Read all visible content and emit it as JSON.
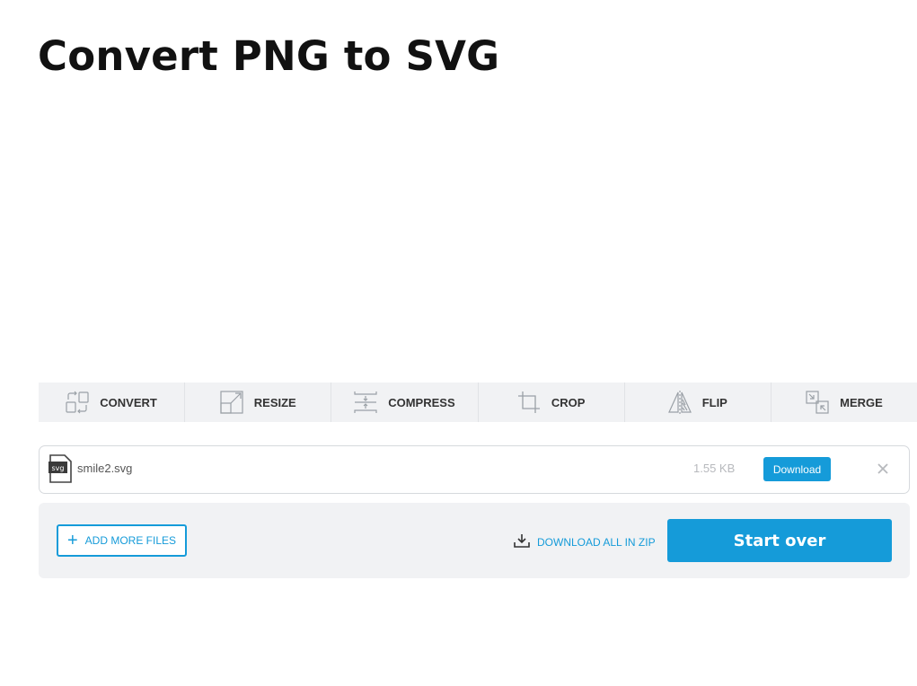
{
  "page": {
    "title": "Convert PNG to SVG"
  },
  "tools": [
    {
      "label": "CONVERT",
      "icon": "convert-icon"
    },
    {
      "label": "RESIZE",
      "icon": "resize-icon"
    },
    {
      "label": "COMPRESS",
      "icon": "compress-icon"
    },
    {
      "label": "CROP",
      "icon": "crop-icon"
    },
    {
      "label": "FLIP",
      "icon": "flip-icon"
    },
    {
      "label": "MERGE",
      "icon": "merge-icon"
    }
  ],
  "file": {
    "type_badge": "svg",
    "name": "smile2.svg",
    "size": "1.55 KB",
    "download_label": "Download",
    "remove_icon": "close-icon"
  },
  "actions": {
    "add_more_label": "ADD MORE FILES",
    "download_zip_label": "DOWNLOAD ALL IN ZIP",
    "start_over_label": "Start over"
  },
  "colors": {
    "accent": "#159bd9",
    "toolbar_bg": "#f1f2f4",
    "muted_text": "#b7b9bd"
  }
}
